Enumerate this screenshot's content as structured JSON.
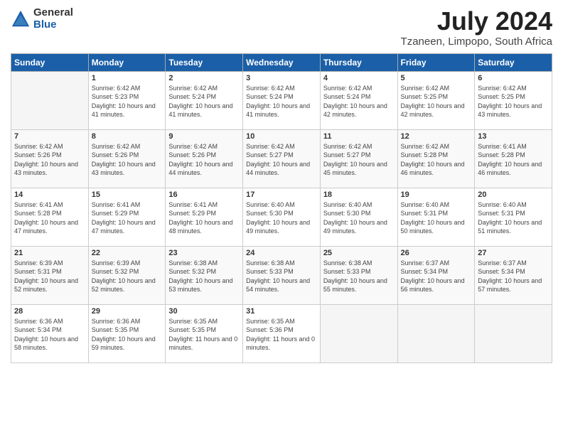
{
  "logo": {
    "general": "General",
    "blue": "Blue"
  },
  "title": "July 2024",
  "location": "Tzaneen, Limpopo, South Africa",
  "days_of_week": [
    "Sunday",
    "Monday",
    "Tuesday",
    "Wednesday",
    "Thursday",
    "Friday",
    "Saturday"
  ],
  "weeks": [
    [
      {
        "day": "",
        "info": ""
      },
      {
        "day": "1",
        "info": "Sunrise: 6:42 AM\nSunset: 5:23 PM\nDaylight: 10 hours\nand 41 minutes."
      },
      {
        "day": "2",
        "info": "Sunrise: 6:42 AM\nSunset: 5:24 PM\nDaylight: 10 hours\nand 41 minutes."
      },
      {
        "day": "3",
        "info": "Sunrise: 6:42 AM\nSunset: 5:24 PM\nDaylight: 10 hours\nand 41 minutes."
      },
      {
        "day": "4",
        "info": "Sunrise: 6:42 AM\nSunset: 5:24 PM\nDaylight: 10 hours\nand 42 minutes."
      },
      {
        "day": "5",
        "info": "Sunrise: 6:42 AM\nSunset: 5:25 PM\nDaylight: 10 hours\nand 42 minutes."
      },
      {
        "day": "6",
        "info": "Sunrise: 6:42 AM\nSunset: 5:25 PM\nDaylight: 10 hours\nand 43 minutes."
      }
    ],
    [
      {
        "day": "7",
        "info": "Sunrise: 6:42 AM\nSunset: 5:26 PM\nDaylight: 10 hours\nand 43 minutes."
      },
      {
        "day": "8",
        "info": "Sunrise: 6:42 AM\nSunset: 5:26 PM\nDaylight: 10 hours\nand 43 minutes."
      },
      {
        "day": "9",
        "info": "Sunrise: 6:42 AM\nSunset: 5:26 PM\nDaylight: 10 hours\nand 44 minutes."
      },
      {
        "day": "10",
        "info": "Sunrise: 6:42 AM\nSunset: 5:27 PM\nDaylight: 10 hours\nand 44 minutes."
      },
      {
        "day": "11",
        "info": "Sunrise: 6:42 AM\nSunset: 5:27 PM\nDaylight: 10 hours\nand 45 minutes."
      },
      {
        "day": "12",
        "info": "Sunrise: 6:42 AM\nSunset: 5:28 PM\nDaylight: 10 hours\nand 46 minutes."
      },
      {
        "day": "13",
        "info": "Sunrise: 6:41 AM\nSunset: 5:28 PM\nDaylight: 10 hours\nand 46 minutes."
      }
    ],
    [
      {
        "day": "14",
        "info": "Sunrise: 6:41 AM\nSunset: 5:28 PM\nDaylight: 10 hours\nand 47 minutes."
      },
      {
        "day": "15",
        "info": "Sunrise: 6:41 AM\nSunset: 5:29 PM\nDaylight: 10 hours\nand 47 minutes."
      },
      {
        "day": "16",
        "info": "Sunrise: 6:41 AM\nSunset: 5:29 PM\nDaylight: 10 hours\nand 48 minutes."
      },
      {
        "day": "17",
        "info": "Sunrise: 6:40 AM\nSunset: 5:30 PM\nDaylight: 10 hours\nand 49 minutes."
      },
      {
        "day": "18",
        "info": "Sunrise: 6:40 AM\nSunset: 5:30 PM\nDaylight: 10 hours\nand 49 minutes."
      },
      {
        "day": "19",
        "info": "Sunrise: 6:40 AM\nSunset: 5:31 PM\nDaylight: 10 hours\nand 50 minutes."
      },
      {
        "day": "20",
        "info": "Sunrise: 6:40 AM\nSunset: 5:31 PM\nDaylight: 10 hours\nand 51 minutes."
      }
    ],
    [
      {
        "day": "21",
        "info": "Sunrise: 6:39 AM\nSunset: 5:31 PM\nDaylight: 10 hours\nand 52 minutes."
      },
      {
        "day": "22",
        "info": "Sunrise: 6:39 AM\nSunset: 5:32 PM\nDaylight: 10 hours\nand 52 minutes."
      },
      {
        "day": "23",
        "info": "Sunrise: 6:38 AM\nSunset: 5:32 PM\nDaylight: 10 hours\nand 53 minutes."
      },
      {
        "day": "24",
        "info": "Sunrise: 6:38 AM\nSunset: 5:33 PM\nDaylight: 10 hours\nand 54 minutes."
      },
      {
        "day": "25",
        "info": "Sunrise: 6:38 AM\nSunset: 5:33 PM\nDaylight: 10 hours\nand 55 minutes."
      },
      {
        "day": "26",
        "info": "Sunrise: 6:37 AM\nSunset: 5:34 PM\nDaylight: 10 hours\nand 56 minutes."
      },
      {
        "day": "27",
        "info": "Sunrise: 6:37 AM\nSunset: 5:34 PM\nDaylight: 10 hours\nand 57 minutes."
      }
    ],
    [
      {
        "day": "28",
        "info": "Sunrise: 6:36 AM\nSunset: 5:34 PM\nDaylight: 10 hours\nand 58 minutes."
      },
      {
        "day": "29",
        "info": "Sunrise: 6:36 AM\nSunset: 5:35 PM\nDaylight: 10 hours\nand 59 minutes."
      },
      {
        "day": "30",
        "info": "Sunrise: 6:35 AM\nSunset: 5:35 PM\nDaylight: 11 hours\nand 0 minutes."
      },
      {
        "day": "31",
        "info": "Sunrise: 6:35 AM\nSunset: 5:36 PM\nDaylight: 11 hours\nand 0 minutes."
      },
      {
        "day": "",
        "info": ""
      },
      {
        "day": "",
        "info": ""
      },
      {
        "day": "",
        "info": ""
      }
    ]
  ]
}
